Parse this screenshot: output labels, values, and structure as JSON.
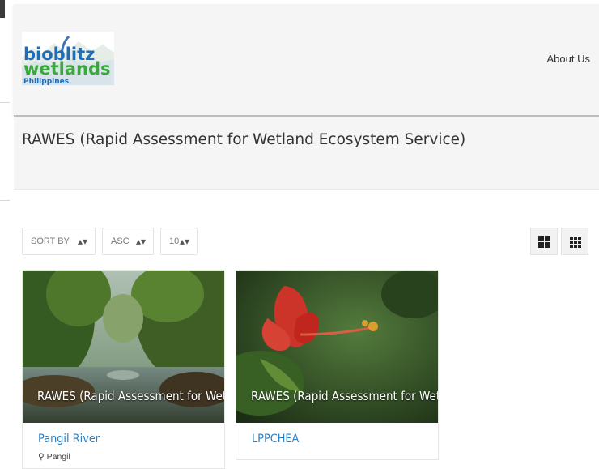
{
  "header": {
    "logo": {
      "line1": "bioblitz",
      "line2": "wetlands",
      "line3": "Philippines"
    },
    "nav": {
      "about": "About Us"
    }
  },
  "page": {
    "title": "RAWES (Rapid Assessment for Wetland Ecosystem Service)"
  },
  "controls": {
    "sort_by": {
      "label": "SORT BY",
      "icon": "sort-arrows-icon"
    },
    "order": {
      "label": "ASC",
      "icon": "sort-arrows-icon"
    },
    "per_page": {
      "label": "10",
      "icon": "sort-arrows-icon"
    },
    "view_large_grid": {
      "icon": "grid-2x2-icon"
    },
    "view_small_grid": {
      "icon": "grid-3x3-icon"
    }
  },
  "listings": [
    {
      "category": "RAWES (Rapid Assessment for Wet",
      "title": "Pangil River",
      "location": "Pangil",
      "location_icon": "map-marker-icon"
    },
    {
      "category": "RAWES (Rapid Assessment for Wet",
      "title": "LPPCHEA"
    }
  ],
  "colors": {
    "link": "#2d7fc1",
    "panel": "#f5f5f5",
    "logo_blue": "#1f6db7",
    "logo_green": "#3aa83a"
  }
}
